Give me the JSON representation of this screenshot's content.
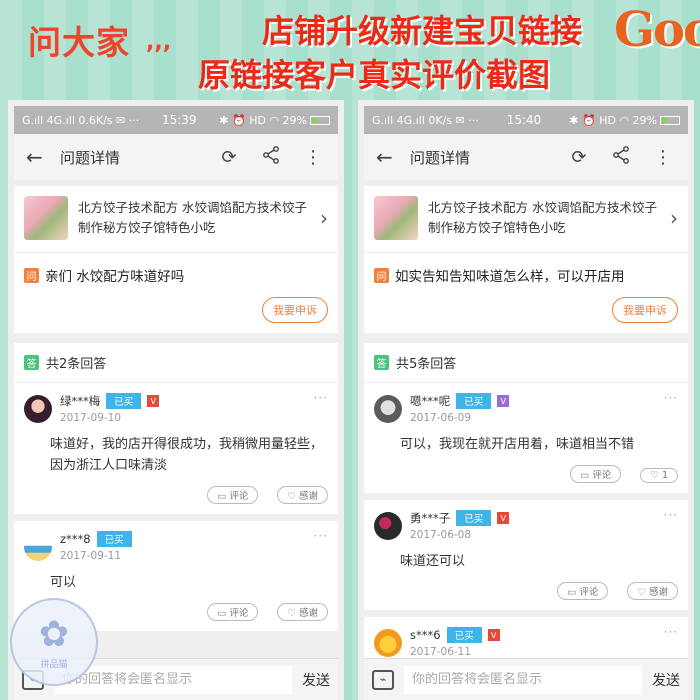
{
  "banner": {
    "ask_all": "问大家",
    "dots": ",,,",
    "headline": "店铺升级新建宝贝链接",
    "headline2": "原链接客户真实评价截图",
    "logo_text": "Goo"
  },
  "watermark": {
    "text": "拼品猫"
  },
  "phones": [
    {
      "status": {
        "left": "G.ıll 4G.ıll 0.6K/s ✉ ···",
        "time": "15:39",
        "right": "✱ ⏰ HD ◠ 29%"
      },
      "title": "问题详情",
      "product_title": "北方饺子技术配方 水饺调馅配方技术饺子制作秘方饺子馆特色小吃",
      "question_badge": "问",
      "question": "亲们 水饺配方味道好吗",
      "appeal": "我要申诉",
      "answer_badge": "答",
      "answer_count": "共2条回答",
      "answers": [
        {
          "name": "绿***梅",
          "bought": "已买",
          "date": "2017-09-10",
          "text": "味道好，我的店开得很成功，我稍微用量轻些，因为浙江人口味清淡",
          "comment": "评论",
          "thanks": "感谢",
          "avatar_color": "#3a1d2c",
          "level_color": "#e8483a"
        },
        {
          "name": "z***8",
          "bought": "已买",
          "date": "2017-09-11",
          "text": "可以",
          "comment": "评论",
          "thanks": "感谢",
          "avatar_color": "#4aa7d6",
          "level_color": ""
        }
      ],
      "reply_placeholder": "你的回答将会匿名显示",
      "send": "发送"
    },
    {
      "status": {
        "left": "G.ıll 4G.ıll 0K/s ✉ ···",
        "time": "15:40",
        "right": "✱ ⏰ HD ◠ 29%"
      },
      "title": "问题详情",
      "product_title": "北方饺子技术配方 水饺调馅配方技术饺子制作秘方饺子馆特色小吃",
      "question_badge": "问",
      "question": "如实告知告知味道怎么样，可以开店用",
      "appeal": "我要申诉",
      "answer_badge": "答",
      "answer_count": "共5条回答",
      "answers": [
        {
          "name": "嗯***呢",
          "bought": "已买",
          "date": "2017-06-09",
          "text": "可以，我现在就开店用着，味道相当不错",
          "comment": "评论",
          "thanks": "1",
          "avatar_color": "#5b5b5b",
          "level_color": "#9b6bd6"
        },
        {
          "name": "勇***子",
          "bought": "已买",
          "date": "2017-06-08",
          "text": "味道还可以",
          "comment": "评论",
          "thanks": "感谢",
          "avatar_color": "#2a2a2a",
          "level_color": "#e8483a"
        },
        {
          "name": "s***6",
          "bought": "已买",
          "date": "2017-06-11",
          "text": "",
          "comment": "",
          "thanks": "",
          "avatar_color": "#f29a1e",
          "level_color": "#e8483a"
        }
      ],
      "reply_placeholder": "你的回答将会匿名显示",
      "send": "发送"
    }
  ]
}
